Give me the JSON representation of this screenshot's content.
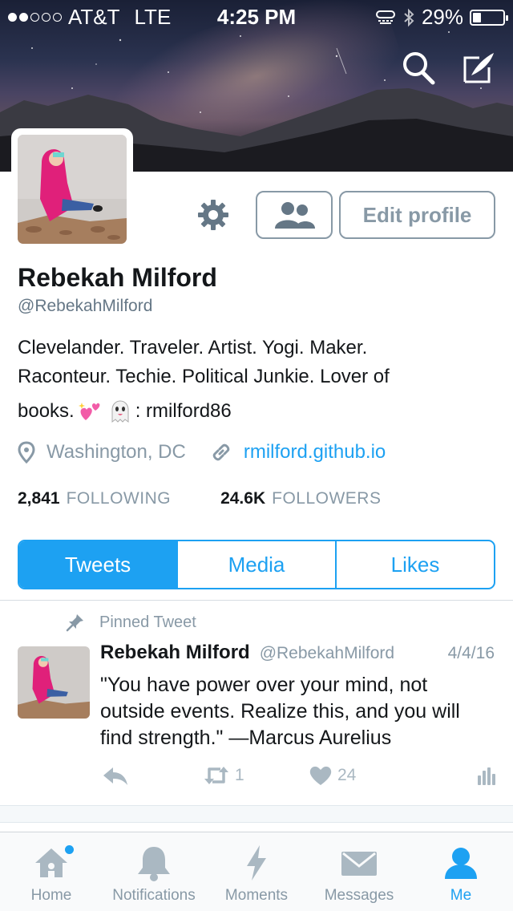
{
  "status_bar": {
    "carrier": "AT&T",
    "network": "LTE",
    "time": "4:25 PM",
    "battery": "29%",
    "battery_level": 0.29
  },
  "profile": {
    "name": "Rebekah Milford",
    "handle": "@RebekahMilford",
    "bio_line1": "Clevelander. Traveler. Artist. Yogi. Maker.",
    "bio_line2": "Raconteur. Techie. Political Junkie. Lover of",
    "bio_line3_start": "books.",
    "bio_line3_end": ": rmilford86",
    "location": "Washington, DC",
    "website": "rmilford.github.io",
    "following_count": "2,841",
    "following_label": "FOLLOWING",
    "followers_count": "24.6K",
    "followers_label": "FOLLOWERS",
    "edit_label": "Edit profile"
  },
  "tabs": [
    {
      "label": "Tweets",
      "active": true
    },
    {
      "label": "Media",
      "active": false
    },
    {
      "label": "Likes",
      "active": false
    }
  ],
  "pinned_tweet": {
    "pinned_label": "Pinned Tweet",
    "author_name": "Rebekah Milford",
    "author_handle": "@RebekahMilford",
    "date": "4/4/16",
    "text": "\"You have power over your mind, not outside events. Realize this, and you will find strength.\" —Marcus Aurelius",
    "retweets": "1",
    "likes": "24"
  },
  "tabbar": [
    {
      "label": "Home",
      "icon": "home-icon"
    },
    {
      "label": "Notifications",
      "icon": "bell-icon"
    },
    {
      "label": "Moments",
      "icon": "lightning-icon"
    },
    {
      "label": "Messages",
      "icon": "envelope-icon"
    },
    {
      "label": "Me",
      "icon": "person-icon",
      "active": true
    }
  ],
  "colors": {
    "accent": "#1da1f2",
    "muted": "#8899a6",
    "text": "#14171a",
    "jacket": "#e0207a"
  }
}
